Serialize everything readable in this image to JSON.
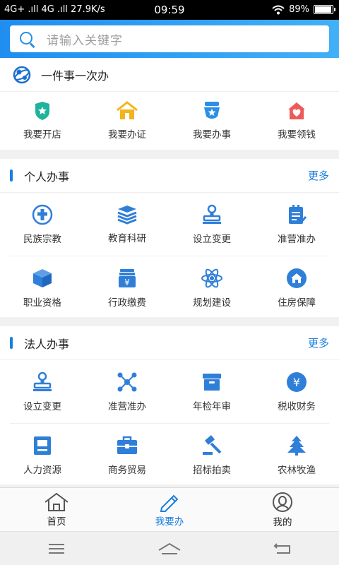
{
  "status_bar": {
    "left": "4G+ .ıll 4G .ıll 27.9K/s",
    "time": "09:59",
    "battery": "89%",
    "battery_level": 0.89
  },
  "search": {
    "placeholder": "请输入关键字"
  },
  "one_thing": {
    "title": "一件事一次办",
    "items": [
      {
        "label": "我要开店",
        "icon": "shield-badge-icon",
        "color": "#1fb39a"
      },
      {
        "label": "我要办证",
        "icon": "house-icon",
        "color": "#f5b31b"
      },
      {
        "label": "我要办事",
        "icon": "police-badge-icon",
        "color": "#2a8fe6"
      },
      {
        "label": "我要领钱",
        "icon": "heart-house-icon",
        "color": "#ee5a5a"
      }
    ]
  },
  "personal": {
    "title": "个人办事",
    "more": "更多",
    "items": [
      {
        "label": "民族宗教",
        "icon": "cross-circle-icon"
      },
      {
        "label": "教育科研",
        "icon": "books-stack-icon"
      },
      {
        "label": "设立变更",
        "icon": "stamp-icon"
      },
      {
        "label": "准营准办",
        "icon": "clipboard-check-icon"
      },
      {
        "label": "职业资格",
        "icon": "box-icon"
      },
      {
        "label": "行政缴费",
        "icon": "yen-wallet-icon"
      },
      {
        "label": "规划建设",
        "icon": "atom-icon"
      },
      {
        "label": "住房保障",
        "icon": "home-circle-icon"
      }
    ]
  },
  "legal": {
    "title": "法人办事",
    "more": "更多",
    "items": [
      {
        "label": "设立变更",
        "icon": "stamp-icon"
      },
      {
        "label": "准营准办",
        "icon": "network-icon"
      },
      {
        "label": "年检年审",
        "icon": "archive-box-icon"
      },
      {
        "label": "税收财务",
        "icon": "yen-circle-icon"
      },
      {
        "label": "人力资源",
        "icon": "id-card-icon"
      },
      {
        "label": "商务贸易",
        "icon": "briefcase-icon"
      },
      {
        "label": "招标拍卖",
        "icon": "gavel-icon"
      },
      {
        "label": "农林牧渔",
        "icon": "tree-icon"
      }
    ]
  },
  "tabs": [
    {
      "label": "首页",
      "icon": "home-outline-icon",
      "active": false
    },
    {
      "label": "我要办",
      "icon": "pencil-icon",
      "active": true
    },
    {
      "label": "我的",
      "icon": "user-circle-icon",
      "active": false
    }
  ],
  "colors": {
    "accent": "#1a7fe0",
    "header_start": "#1f8ef0",
    "header_end": "#42b0f7"
  }
}
